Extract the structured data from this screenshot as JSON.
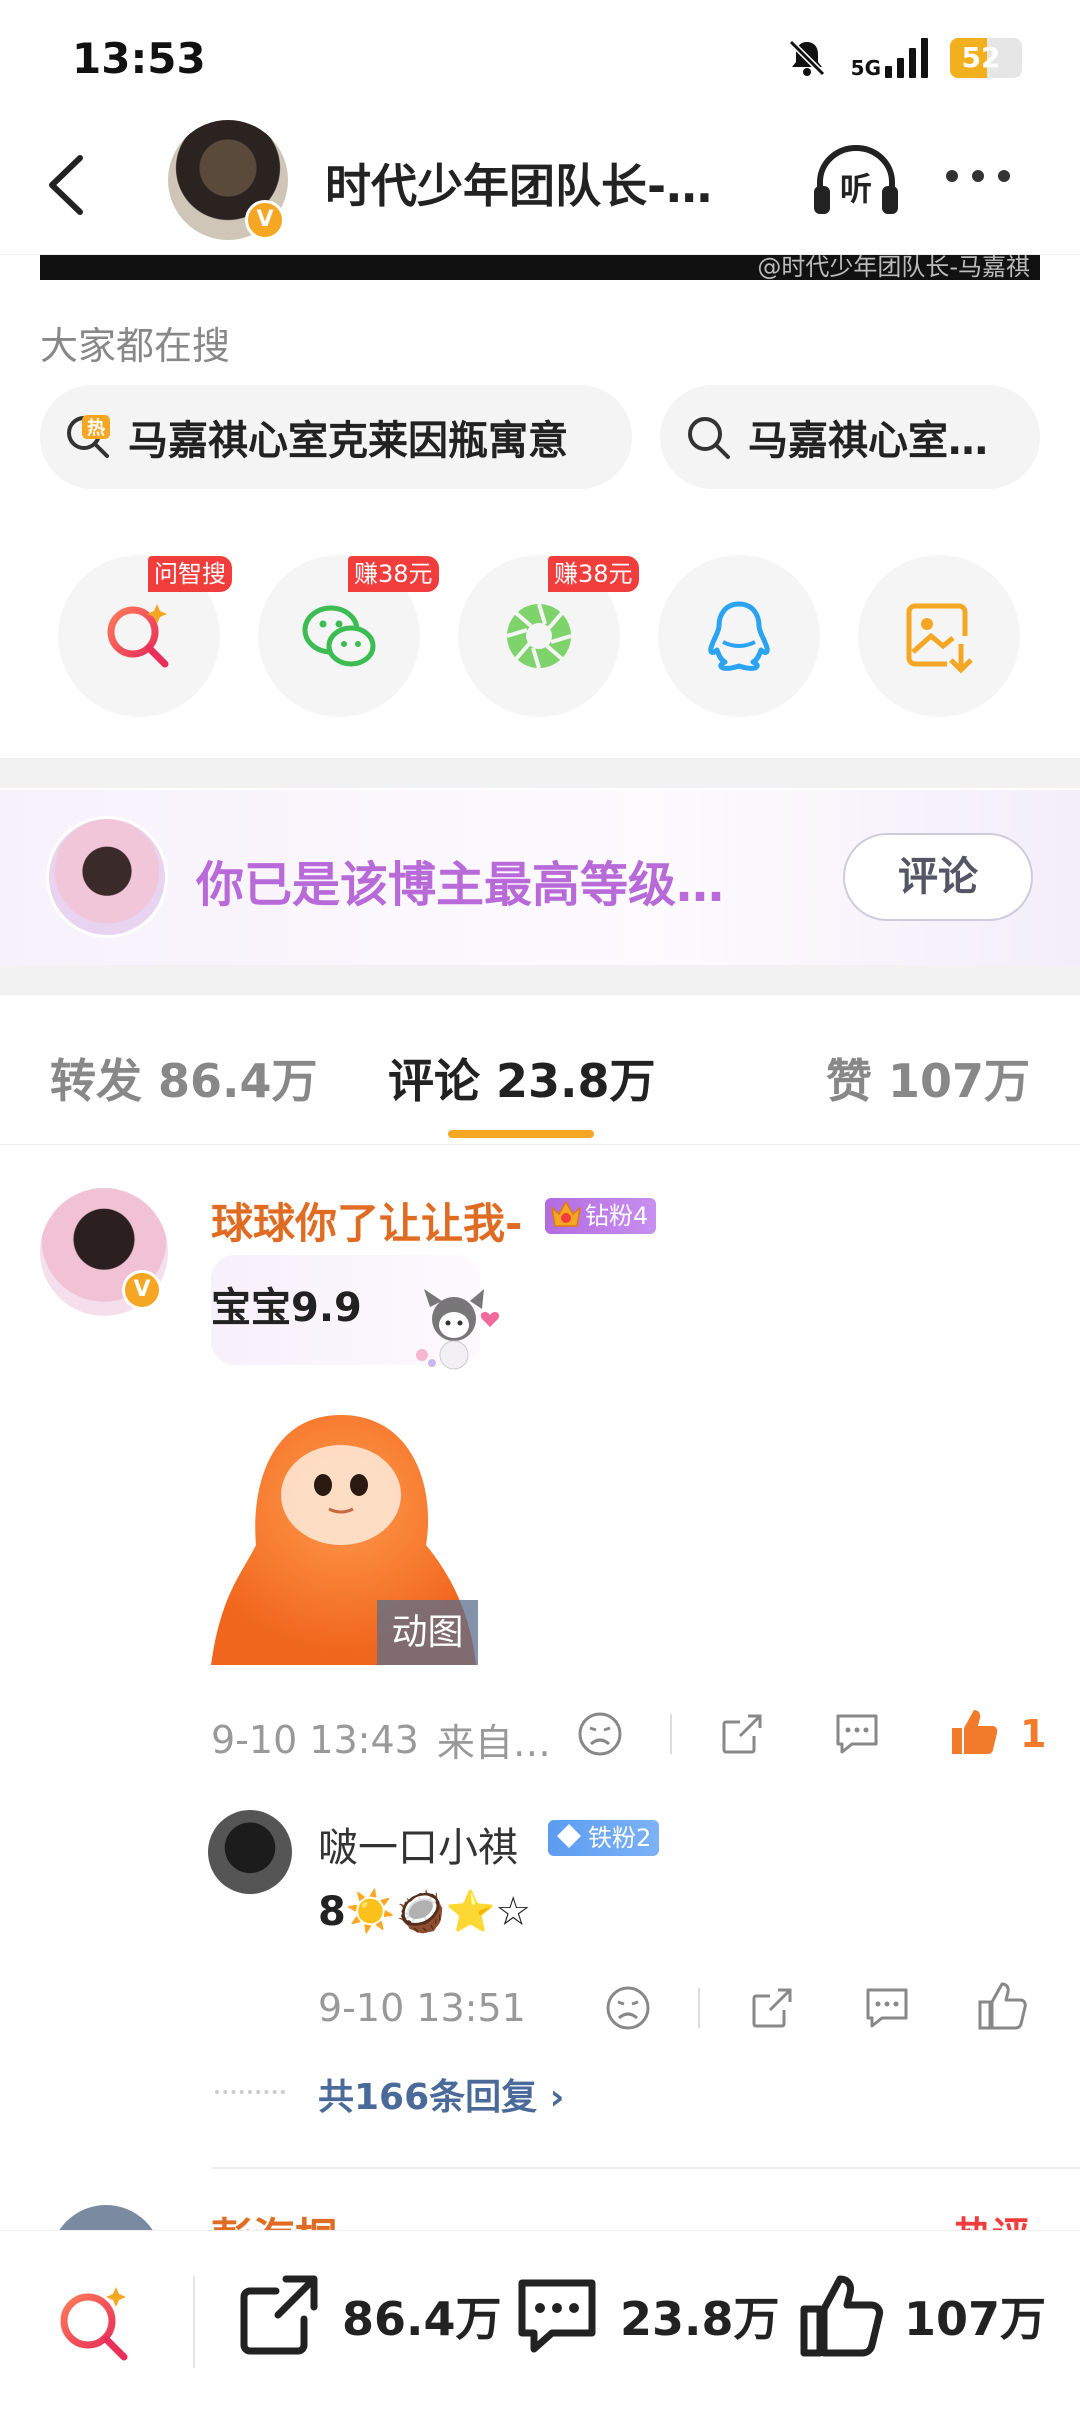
{
  "status_bar": {
    "time": "13:53",
    "network": "5G",
    "battery": "52",
    "battery_level": 0.52
  },
  "nav": {
    "title": "时代少年团队长-…",
    "listen_label": "听",
    "verified_badge": "V"
  },
  "image_strip": {
    "watermark": "@时代少年团队长-马嘉祺"
  },
  "search": {
    "title": "大家都在搜",
    "hot_tag": "热",
    "chips": [
      "马嘉祺心室克莱因瓶寓意",
      "马嘉祺心室…"
    ]
  },
  "share": {
    "tags": [
      "问智搜",
      "赚38元",
      "赚38元"
    ],
    "icons": [
      "ai-search-icon",
      "wechat-icon",
      "moments-icon",
      "qq-icon",
      "save-image-icon"
    ]
  },
  "banner": {
    "text": "你已是该博主最高等级…",
    "button": "评论"
  },
  "tabs": {
    "repost": "转发 86.4万",
    "comments": "评论 23.8万",
    "likes": "赞 107万"
  },
  "comment": {
    "author": "球球你了让让我-",
    "badge": "钻粉4",
    "text": "宝宝9.9",
    "gif_label": "动图",
    "time": "9-10 13:43",
    "source": "来自…",
    "like_count": "1"
  },
  "reply": {
    "author": "啵一口小祺",
    "badge": "铁粉2",
    "text": "8☀️🥥⭐☆",
    "time": "9-10 13:51"
  },
  "more_replies": "共166条回复 ›",
  "next_comment": {
    "author": "彭海桐",
    "tag": "热评"
  },
  "bottom_bar": {
    "reposts": "86.4万",
    "comments": "23.8万",
    "likes": "107万"
  },
  "colors": {
    "accent": "#f5a623",
    "name_orange": "#e06b22",
    "banner_purple": "#b76ad8",
    "tag_red": "#f23d3d"
  }
}
